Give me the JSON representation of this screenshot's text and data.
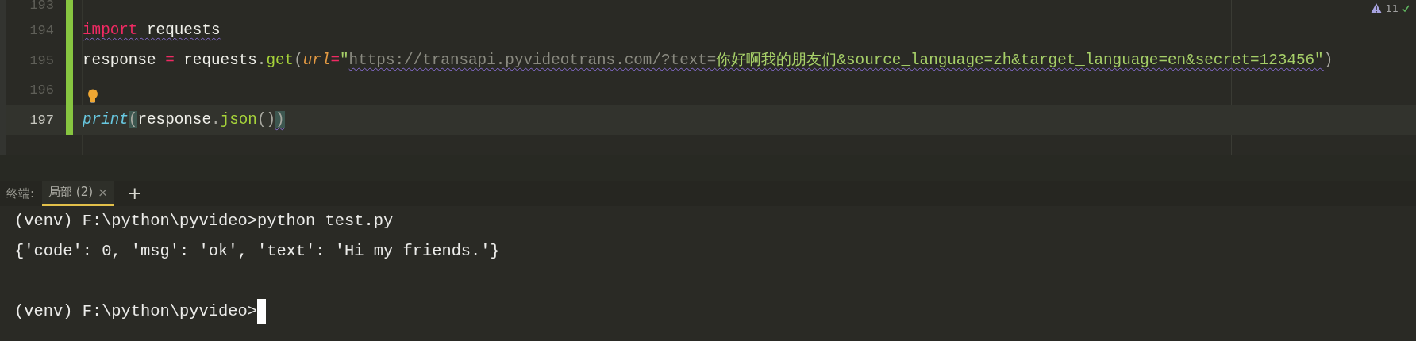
{
  "editor": {
    "inspection": {
      "count": "11"
    },
    "lines": [
      {
        "number": "193",
        "changed": true,
        "current": false
      },
      {
        "number": "194",
        "changed": true,
        "current": false,
        "tokens": [
          {
            "kind": "keyword",
            "text": "import",
            "squiggle": true
          },
          {
            "kind": "plain",
            "text": " requests",
            "squiggle": true
          }
        ]
      },
      {
        "number": "195",
        "changed": true,
        "current": false,
        "tokens": [
          {
            "kind": "plain",
            "text": "response "
          },
          {
            "kind": "op",
            "text": "="
          },
          {
            "kind": "plain",
            "text": " requests"
          },
          {
            "kind": "dot",
            "text": "."
          },
          {
            "kind": "func",
            "text": "get"
          },
          {
            "kind": "paren",
            "text": "("
          },
          {
            "kind": "param",
            "text": "url"
          },
          {
            "kind": "op",
            "text": "="
          },
          {
            "kind": "string",
            "text": "\""
          },
          {
            "kind": "url",
            "text": "https://transapi.pyvideotrans.com/?text=",
            "squiggle": true
          },
          {
            "kind": "string",
            "text": "你好啊我的朋友们&source_language=zh&target_language=en&secret=123456\"",
            "squiggle": true
          },
          {
            "kind": "paren",
            "text": ")"
          }
        ]
      },
      {
        "number": "196",
        "changed": true,
        "current": false,
        "bulb": true
      },
      {
        "number": "197",
        "changed": true,
        "current": true,
        "tokens": [
          {
            "kind": "builtin",
            "text": "print"
          },
          {
            "kind": "paren",
            "text": "(",
            "matched": true
          },
          {
            "kind": "plain",
            "text": "response"
          },
          {
            "kind": "dot",
            "text": "."
          },
          {
            "kind": "func",
            "text": "json"
          },
          {
            "kind": "paren",
            "text": "()"
          },
          {
            "kind": "paren",
            "text": ")",
            "matched": true,
            "squiggle": true
          }
        ]
      }
    ]
  },
  "terminal": {
    "label": "终端:",
    "tabs": [
      {
        "label": "局部 (2)",
        "selected": true,
        "close": "×"
      }
    ],
    "new_tab": "+",
    "lines": [
      {
        "kind": "output",
        "text": "(venv) F:\\python\\pyvideo>python test.py"
      },
      {
        "kind": "output",
        "text": "{'code': 0, 'msg': 'ok', 'text': 'Hi my friends.'}"
      },
      {
        "kind": "blank"
      },
      {
        "kind": "prompt",
        "text": "(venv) F:\\python\\pyvideo>",
        "cursor": true
      }
    ]
  }
}
